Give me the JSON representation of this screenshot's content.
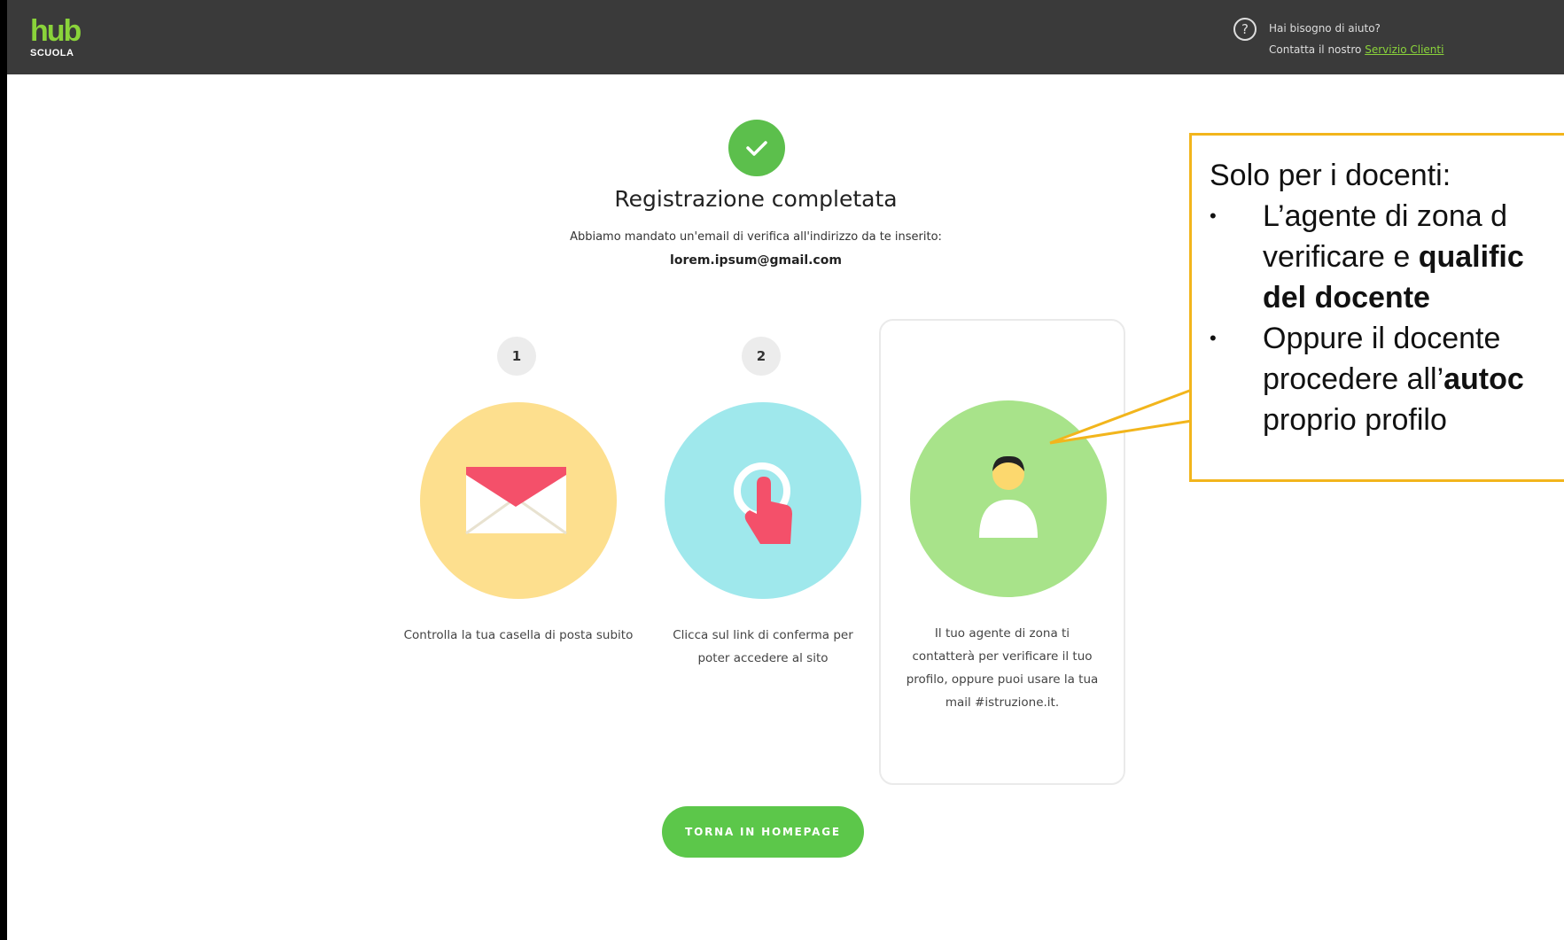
{
  "header": {
    "logo_main": "hub",
    "logo_sub": "SCUOLA",
    "help_icon": "?",
    "help_line1": "Hai bisogno di aiuto?",
    "help_line2_prefix": "Contatta il nostro",
    "help_link": "Servizio Clienti"
  },
  "confirmation": {
    "title": "Registrazione completata",
    "subtitle": "Abbiamo mandato un'email di verifica all'indirizzo da te inserito:",
    "email": "lorem.ipsum@gmail.com"
  },
  "steps": [
    {
      "number": "1",
      "icon": "envelope-icon",
      "text": "Controlla la tua casella di posta subito",
      "color": "#fddf8e"
    },
    {
      "number": "2",
      "icon": "click-icon",
      "text": "Clicca sul link di conferma per poter accedere al sito",
      "color": "#9fe8ec"
    },
    {
      "icon": "user-icon",
      "text": "Il tuo agente di zona ti contatterà per verificare il tuo profilo, oppure puoi usare la tua mail #istruzione.it.",
      "color": "#a8e38a"
    }
  ],
  "home_button": "TORNA IN HOMEPAGE",
  "callout": {
    "heading": "Solo per i docenti:",
    "b1_line1": "L’agente di zona d",
    "b1_line2_pre": "verificare e ",
    "b1_line2_bold": "qualific",
    "b1_line3_bold": "del docente",
    "b2_line1": "Oppure il docente",
    "b2_line2_pre": "procedere all’",
    "b2_line2_bold": "autoc",
    "b2_line3": "proprio profilo",
    "bullet": "•"
  },
  "colors": {
    "accent": "#5cc74a",
    "topbar": "#3a3a3a",
    "callout_border": "#f2b51c"
  }
}
